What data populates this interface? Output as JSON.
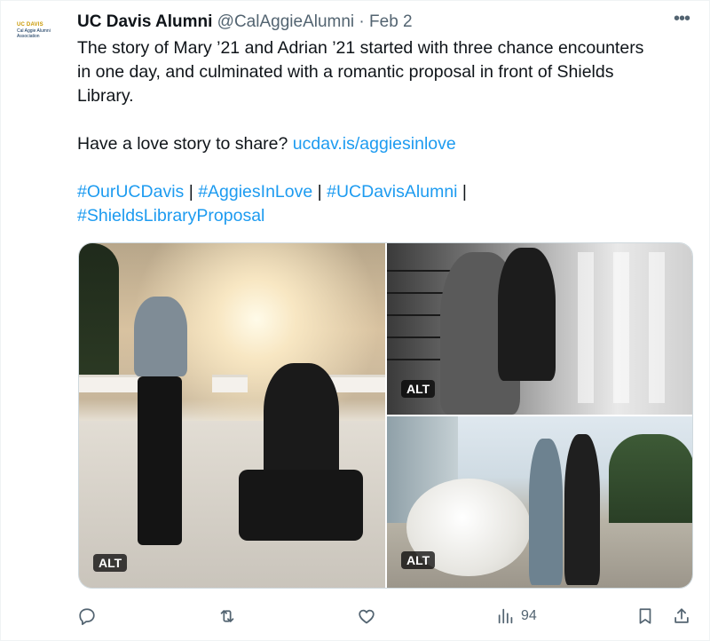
{
  "account": {
    "avatar_line1": "UC DAVIS",
    "avatar_line2": "Cal Aggie Alumni",
    "avatar_line3": "Association",
    "display_name": "UC Davis Alumni",
    "handle": "@CalAggieAlumni",
    "separator": "·",
    "date": "Feb 2"
  },
  "tweet": {
    "line1": "The story of Mary ’21 and Adrian ’21 started with three chance encounters",
    "line2": "in one day, and culminated with a romantic proposal in front of Shields",
    "line3": "Library.",
    "share_prefix": "Have a love story to share? ",
    "share_link": "ucdav.is/aggiesinlove",
    "hashtag1": "#OurUCDavis",
    "hashtag2": "#AggiesInLove",
    "hashtag3": "#UCDavisAlumni",
    "hashtag4": "#ShieldsLibraryProposal",
    "divider": " | ",
    "trailing_divider": " |"
  },
  "media": {
    "alt_badge": "ALT"
  },
  "actions": {
    "reply_icon": "reply-icon",
    "retweet_icon": "retweet-icon",
    "like_icon": "heart-icon",
    "views_icon": "bar-chart-icon",
    "views_count": "94",
    "bookmark_icon": "bookmark-icon",
    "share_icon": "share-icon"
  },
  "colors": {
    "link": "#1d9bf0",
    "muted": "#536471",
    "text": "#0f1419",
    "brand_gold": "#c99700",
    "brand_blue": "#022851"
  }
}
